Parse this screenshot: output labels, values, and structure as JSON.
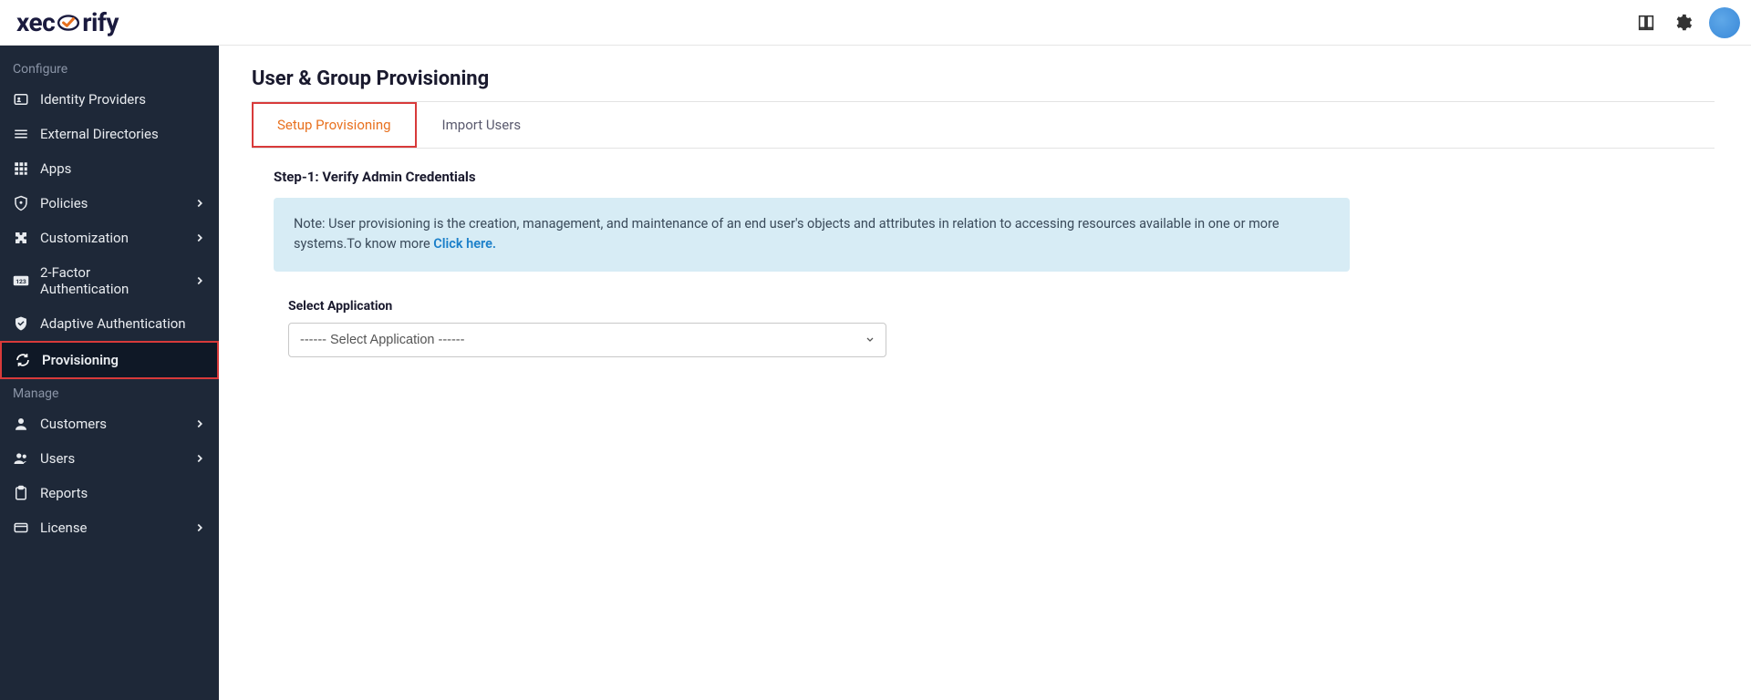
{
  "brand": {
    "name": "xecurify"
  },
  "sidebar": {
    "sections": [
      {
        "label": "Configure",
        "items": [
          {
            "icon": "id-card-icon",
            "label": "Identity Providers",
            "chevron": false
          },
          {
            "icon": "list-icon",
            "label": "External Directories",
            "chevron": false
          },
          {
            "icon": "grid-icon",
            "label": "Apps",
            "chevron": false
          },
          {
            "icon": "shield-icon",
            "label": "Policies",
            "chevron": true
          },
          {
            "icon": "puzzle-icon",
            "label": "Customization",
            "chevron": true
          },
          {
            "icon": "numbers-icon",
            "label": "2-Factor Authentication",
            "chevron": true
          },
          {
            "icon": "check-shield-icon",
            "label": "Adaptive Authentication",
            "chevron": false
          },
          {
            "icon": "sync-icon",
            "label": "Provisioning",
            "chevron": false,
            "active": true
          }
        ]
      },
      {
        "label": "Manage",
        "items": [
          {
            "icon": "person-icon",
            "label": "Customers",
            "chevron": true
          },
          {
            "icon": "people-icon",
            "label": "Users",
            "chevron": true
          },
          {
            "icon": "clipboard-icon",
            "label": "Reports",
            "chevron": false
          },
          {
            "icon": "card-icon",
            "label": "License",
            "chevron": true
          }
        ]
      }
    ]
  },
  "page": {
    "title": "User & Group Provisioning",
    "tabs": [
      {
        "label": "Setup Provisioning",
        "active": true
      },
      {
        "label": "Import Users",
        "active": false
      }
    ],
    "step_heading": "Step-1: Verify Admin Credentials",
    "info_note_prefix": "Note: User provisioning is the creation, management, and maintenance of an end user's objects and attributes in relation to accessing resources available in one or more systems.To know more ",
    "info_link": "Click here.",
    "select_label": "Select Application",
    "select_placeholder": "------ Select Application ------"
  }
}
